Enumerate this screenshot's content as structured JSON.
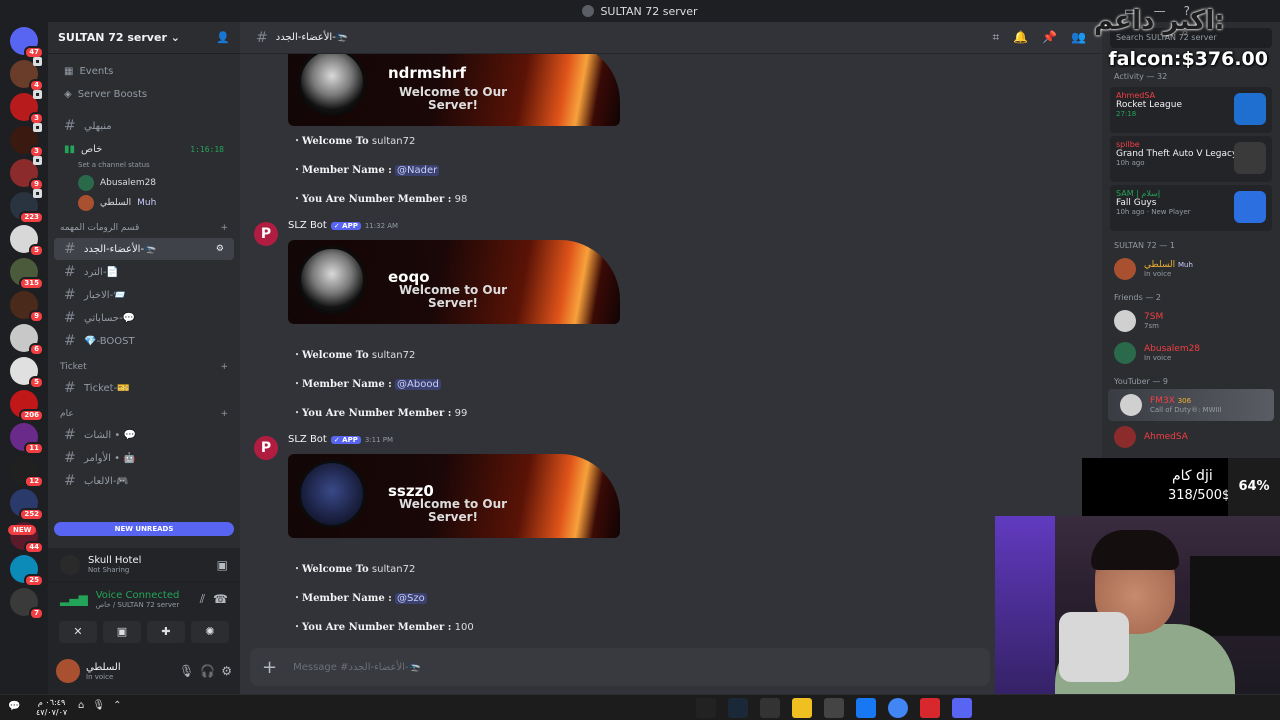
{
  "window": {
    "title": "SULTAN 72 server"
  },
  "rail": {
    "new_badge": "NEW",
    "badges": [
      "47",
      "4",
      "3",
      "3",
      "9",
      "223",
      "5",
      "315",
      "9",
      "6",
      "5",
      "206",
      "11",
      "12",
      "252",
      "44",
      "25",
      "7"
    ]
  },
  "sidebar": {
    "server_name": "SULTAN 72 server",
    "events": "Events",
    "boosts": "Server Boosts",
    "channels_top": [
      "منبهلي"
    ],
    "voice_channel": {
      "name": "خاص",
      "timer": "1:16:18",
      "status": "Set a channel status",
      "users": [
        "Abusalem28",
        "السلطي"
      ],
      "user2_tag": "Muh"
    },
    "category1": "قسم الرومات المهمه",
    "channels_cat1": [
      "الأعضاء-الجدد-🛬",
      "الترد-📄",
      "الاخبار-📨",
      "حساباتي-💬",
      "💎-BOOST"
    ],
    "category2": "Ticket",
    "ticket_channel": "Ticket-🎫",
    "category3": "عام",
    "channels_cat3": [
      "الشات • 💬",
      "الأوامر • 🤖",
      "الالعاب-🎮"
    ],
    "new_unreads": "NEW UNREADS",
    "activity": {
      "title": "Skull Hotel",
      "sub": "Not Sharing"
    },
    "voice": {
      "status": "Voice Connected",
      "where": "خاص / SULTAN 72 server"
    },
    "user": {
      "name": "السلطي",
      "status": "In voice"
    }
  },
  "main": {
    "channel": "الأعضاء-الجدد-🛬",
    "composer_placeholder": "Message #الأعضاء-الجدد-🛬",
    "welcome_text": "Welcome to Our Server!",
    "label_welcome": "Welcome To",
    "label_member": "Member Name :",
    "label_number": "You Are Number Member :",
    "server": "sultan72",
    "bot_name": "SLZ Bot",
    "app_badge": "✓ APP",
    "messages": [
      {
        "card_name": "ndrmshrf",
        "mention": "@Nader",
        "number": "98",
        "author": "",
        "time": ""
      },
      {
        "card_name": "eoqo",
        "mention": "@Abood",
        "number": "99",
        "author": "SLZ Bot",
        "time": "11:32 AM"
      },
      {
        "card_name": "sszz0",
        "mention": "@Szo",
        "number": "100",
        "author": "SLZ Bot",
        "time": "3:11 PM"
      }
    ]
  },
  "members": {
    "search_placeholder": "Search SULTAN 72 server",
    "activity_header": "Activity — 32",
    "activities": [
      {
        "who": "AhmedSA",
        "game": "Rocket League",
        "meta": "27:18",
        "color": "#1f6fd1"
      },
      {
        "who": "spilbe",
        "game": "Grand Theft Auto V Legacy",
        "meta": "10h ago",
        "color": "#3a3a3a"
      },
      {
        "who": "SAM | إسلام",
        "game": "Fall Guys",
        "meta": "10h ago · New Player",
        "color": "#2c6fe0"
      }
    ],
    "group1": "SULTAN 72 — 1",
    "g1_member": {
      "name": "السلطي",
      "tag": "Muh",
      "status": "In voice"
    },
    "group2": "Friends — 2",
    "friends": [
      {
        "name": "7SM",
        "status": "7sm"
      },
      {
        "name": "Abusalem28",
        "status": "In voice"
      }
    ],
    "group3": "YouTuber — 9",
    "youtubers": [
      {
        "name": "FM3X",
        "badge": "306",
        "status": "Call of Duty®: MWIII"
      },
      {
        "name": "AhmedSA",
        "status": ""
      }
    ]
  },
  "overlay": {
    "arabic_text": "اكبر داعم:",
    "falcon": "falcon:$376.00",
    "goal_label": "كام dji",
    "goal_amount": "318/500$",
    "goal_pct": "64%"
  },
  "taskbar": {
    "time": "٠٦:٤٩ م",
    "date": "٤٧/٠٧/٠٧"
  }
}
